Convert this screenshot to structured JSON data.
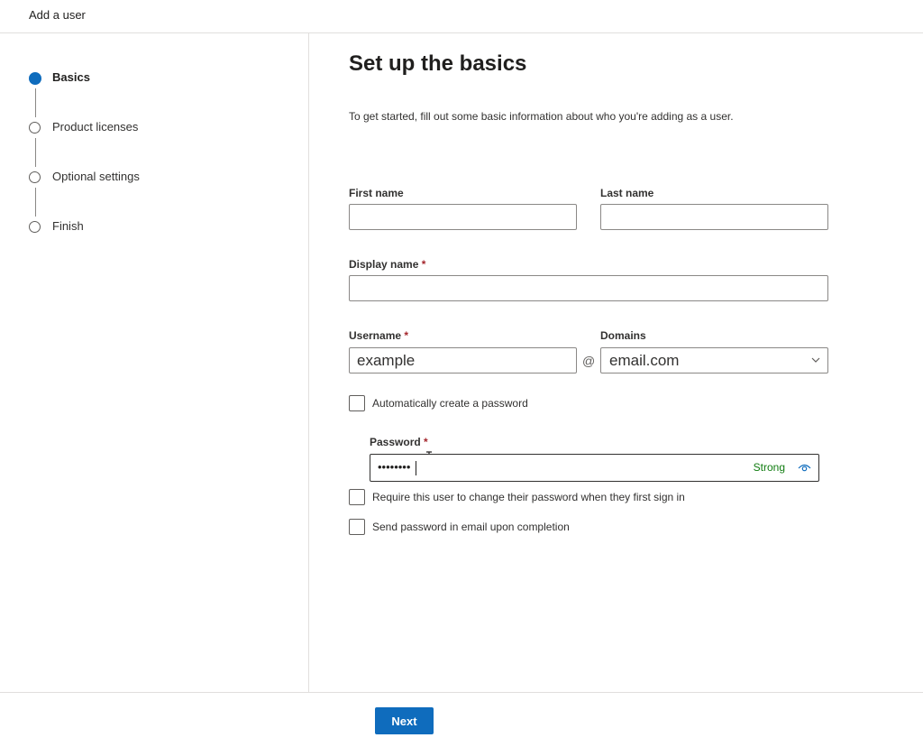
{
  "window": {
    "title": "Add a user"
  },
  "steps": [
    {
      "label": "Basics",
      "state": "current"
    },
    {
      "label": "Product licenses",
      "state": "pending"
    },
    {
      "label": "Optional settings",
      "state": "pending"
    },
    {
      "label": "Finish",
      "state": "pending"
    }
  ],
  "form": {
    "heading": "Set up the basics",
    "intro": "To get started, fill out some basic information about who you're adding as a user.",
    "first_name": {
      "label": "First name",
      "value": ""
    },
    "last_name": {
      "label": "Last name",
      "value": ""
    },
    "display_name": {
      "label": "Display name",
      "required_mark": "*",
      "value": ""
    },
    "username": {
      "label": "Username",
      "required_mark": "*",
      "value": "example"
    },
    "at_symbol": "@",
    "domains": {
      "label": "Domains",
      "selected": "email.com"
    },
    "auto_password": {
      "label": "Automatically create a password",
      "checked": false
    },
    "password": {
      "label": "Password",
      "required_mark": "*",
      "masked_value": "••••••••",
      "strength": "Strong"
    },
    "require_change": {
      "label": "Require this user to change their password when they first sign in",
      "checked": false
    },
    "send_email": {
      "label": "Send password in email upon completion",
      "checked": false
    }
  },
  "footer": {
    "next_label": "Next"
  },
  "colors": {
    "accent": "#0f6cbd",
    "strength_strong": "#107c10",
    "required": "#a4262c"
  },
  "icons": {
    "password_reveal": "eye-icon",
    "domains_dropdown": "chevron-down-icon",
    "cursor": "text-cursor-icon"
  }
}
